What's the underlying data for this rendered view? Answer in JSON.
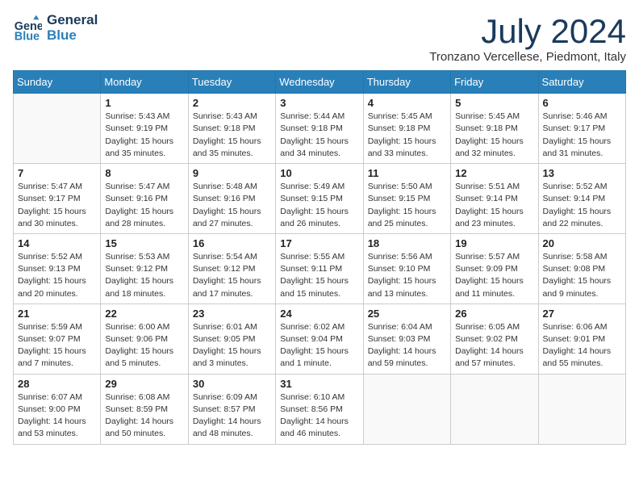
{
  "header": {
    "logo_line1": "General",
    "logo_line2": "Blue",
    "month": "July 2024",
    "location": "Tronzano Vercellese, Piedmont, Italy"
  },
  "weekdays": [
    "Sunday",
    "Monday",
    "Tuesday",
    "Wednesday",
    "Thursday",
    "Friday",
    "Saturday"
  ],
  "weeks": [
    [
      {
        "day": "",
        "info": ""
      },
      {
        "day": "1",
        "info": "Sunrise: 5:43 AM\nSunset: 9:19 PM\nDaylight: 15 hours\nand 35 minutes."
      },
      {
        "day": "2",
        "info": "Sunrise: 5:43 AM\nSunset: 9:18 PM\nDaylight: 15 hours\nand 35 minutes."
      },
      {
        "day": "3",
        "info": "Sunrise: 5:44 AM\nSunset: 9:18 PM\nDaylight: 15 hours\nand 34 minutes."
      },
      {
        "day": "4",
        "info": "Sunrise: 5:45 AM\nSunset: 9:18 PM\nDaylight: 15 hours\nand 33 minutes."
      },
      {
        "day": "5",
        "info": "Sunrise: 5:45 AM\nSunset: 9:18 PM\nDaylight: 15 hours\nand 32 minutes."
      },
      {
        "day": "6",
        "info": "Sunrise: 5:46 AM\nSunset: 9:17 PM\nDaylight: 15 hours\nand 31 minutes."
      }
    ],
    [
      {
        "day": "7",
        "info": "Sunrise: 5:47 AM\nSunset: 9:17 PM\nDaylight: 15 hours\nand 30 minutes."
      },
      {
        "day": "8",
        "info": "Sunrise: 5:47 AM\nSunset: 9:16 PM\nDaylight: 15 hours\nand 28 minutes."
      },
      {
        "day": "9",
        "info": "Sunrise: 5:48 AM\nSunset: 9:16 PM\nDaylight: 15 hours\nand 27 minutes."
      },
      {
        "day": "10",
        "info": "Sunrise: 5:49 AM\nSunset: 9:15 PM\nDaylight: 15 hours\nand 26 minutes."
      },
      {
        "day": "11",
        "info": "Sunrise: 5:50 AM\nSunset: 9:15 PM\nDaylight: 15 hours\nand 25 minutes."
      },
      {
        "day": "12",
        "info": "Sunrise: 5:51 AM\nSunset: 9:14 PM\nDaylight: 15 hours\nand 23 minutes."
      },
      {
        "day": "13",
        "info": "Sunrise: 5:52 AM\nSunset: 9:14 PM\nDaylight: 15 hours\nand 22 minutes."
      }
    ],
    [
      {
        "day": "14",
        "info": "Sunrise: 5:52 AM\nSunset: 9:13 PM\nDaylight: 15 hours\nand 20 minutes."
      },
      {
        "day": "15",
        "info": "Sunrise: 5:53 AM\nSunset: 9:12 PM\nDaylight: 15 hours\nand 18 minutes."
      },
      {
        "day": "16",
        "info": "Sunrise: 5:54 AM\nSunset: 9:12 PM\nDaylight: 15 hours\nand 17 minutes."
      },
      {
        "day": "17",
        "info": "Sunrise: 5:55 AM\nSunset: 9:11 PM\nDaylight: 15 hours\nand 15 minutes."
      },
      {
        "day": "18",
        "info": "Sunrise: 5:56 AM\nSunset: 9:10 PM\nDaylight: 15 hours\nand 13 minutes."
      },
      {
        "day": "19",
        "info": "Sunrise: 5:57 AM\nSunset: 9:09 PM\nDaylight: 15 hours\nand 11 minutes."
      },
      {
        "day": "20",
        "info": "Sunrise: 5:58 AM\nSunset: 9:08 PM\nDaylight: 15 hours\nand 9 minutes."
      }
    ],
    [
      {
        "day": "21",
        "info": "Sunrise: 5:59 AM\nSunset: 9:07 PM\nDaylight: 15 hours\nand 7 minutes."
      },
      {
        "day": "22",
        "info": "Sunrise: 6:00 AM\nSunset: 9:06 PM\nDaylight: 15 hours\nand 5 minutes."
      },
      {
        "day": "23",
        "info": "Sunrise: 6:01 AM\nSunset: 9:05 PM\nDaylight: 15 hours\nand 3 minutes."
      },
      {
        "day": "24",
        "info": "Sunrise: 6:02 AM\nSunset: 9:04 PM\nDaylight: 15 hours\nand 1 minute."
      },
      {
        "day": "25",
        "info": "Sunrise: 6:04 AM\nSunset: 9:03 PM\nDaylight: 14 hours\nand 59 minutes."
      },
      {
        "day": "26",
        "info": "Sunrise: 6:05 AM\nSunset: 9:02 PM\nDaylight: 14 hours\nand 57 minutes."
      },
      {
        "day": "27",
        "info": "Sunrise: 6:06 AM\nSunset: 9:01 PM\nDaylight: 14 hours\nand 55 minutes."
      }
    ],
    [
      {
        "day": "28",
        "info": "Sunrise: 6:07 AM\nSunset: 9:00 PM\nDaylight: 14 hours\nand 53 minutes."
      },
      {
        "day": "29",
        "info": "Sunrise: 6:08 AM\nSunset: 8:59 PM\nDaylight: 14 hours\nand 50 minutes."
      },
      {
        "day": "30",
        "info": "Sunrise: 6:09 AM\nSunset: 8:57 PM\nDaylight: 14 hours\nand 48 minutes."
      },
      {
        "day": "31",
        "info": "Sunrise: 6:10 AM\nSunset: 8:56 PM\nDaylight: 14 hours\nand 46 minutes."
      },
      {
        "day": "",
        "info": ""
      },
      {
        "day": "",
        "info": ""
      },
      {
        "day": "",
        "info": ""
      }
    ]
  ]
}
